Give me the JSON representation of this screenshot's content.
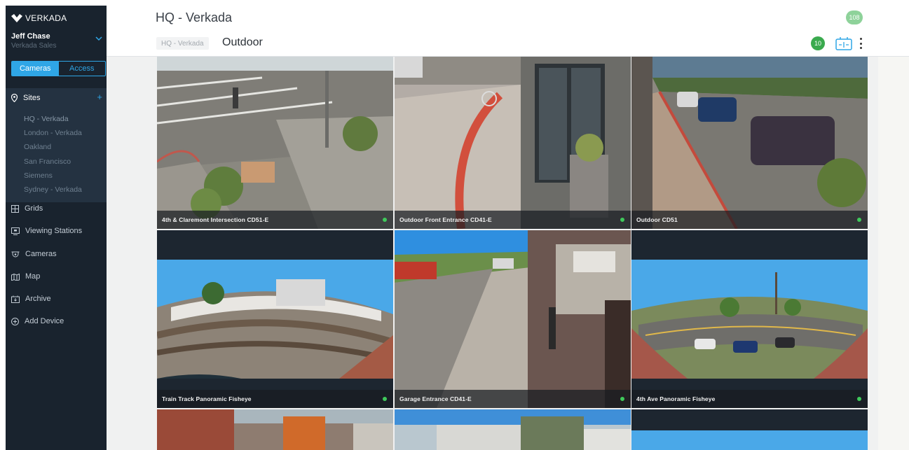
{
  "brand": {
    "name": "VERKADA"
  },
  "user": {
    "name": "Jeff Chase",
    "org": "Verkada Sales"
  },
  "segment": {
    "cameras": "Cameras",
    "access": "Access"
  },
  "sites": {
    "label": "Sites",
    "items": [
      "HQ - Verkada",
      "London - Verkada",
      "Oakland",
      "San Francisco",
      "Siemens",
      "Sydney - Verkada"
    ]
  },
  "nav": [
    {
      "label": "Grids",
      "icon": "grid-icon"
    },
    {
      "label": "Viewing Stations",
      "icon": "monitor-icon"
    },
    {
      "label": "Cameras",
      "icon": "dome-camera-icon"
    },
    {
      "label": "Map",
      "icon": "map-icon"
    },
    {
      "label": "Archive",
      "icon": "archive-icon"
    },
    {
      "label": "Add Device",
      "icon": "add-circle-icon"
    }
  ],
  "header": {
    "title": "HQ - Verkada",
    "total_badge": "108",
    "breadcrumb": "HQ - Verkada",
    "grid_name": "Outdoor",
    "grid_count": "10"
  },
  "colors": {
    "accent": "#2fa6e6",
    "sidebar": "#19232e",
    "online": "#3fc95b"
  },
  "cameras": [
    {
      "name": "4th & Claremont Intersection CD51-E",
      "status": "online"
    },
    {
      "name": "Outdoor Front Entrance CD41-E",
      "status": "online"
    },
    {
      "name": "Outdoor CD51",
      "status": "online"
    },
    {
      "name": "Train Track Panoramic Fisheye",
      "status": "online"
    },
    {
      "name": "Garage Entrance CD41-E",
      "status": "online"
    },
    {
      "name": "4th Ave Panoramic Fisheye",
      "status": "online"
    }
  ]
}
